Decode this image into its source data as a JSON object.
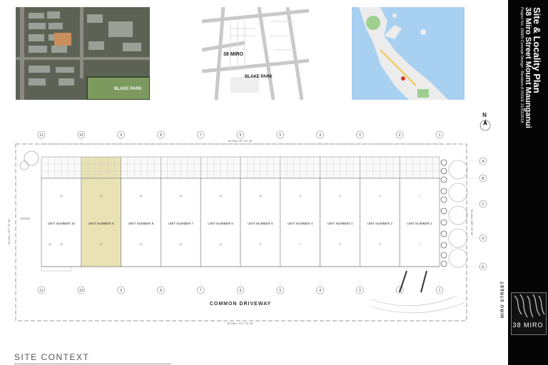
{
  "title_block": {
    "title": "Site & Locality Plan",
    "subtitle": "38 Miro Street Mount Maunganui",
    "project_line": "Project No. 18009   Concept Design - Revision A   ISSUE 21/03/2018"
  },
  "maps": {
    "aerial_label": "BLAKE PARK",
    "street_site_label": "38 MIRO",
    "street_park_label": "BLAKE PARK"
  },
  "plan": {
    "grid_numbers": [
      "11",
      "10",
      "9",
      "8",
      "7",
      "6",
      "5",
      "4",
      "3",
      "2",
      "1"
    ],
    "grid_letters": [
      "A",
      "B",
      "C",
      "D",
      "E"
    ],
    "units": [
      {
        "label": "UNIT NUMBER 10",
        "top_num": "21",
        "bottom_num": "20",
        "mid_num": "19",
        "highlight": false
      },
      {
        "label": "UNIT NUMBER 9",
        "top_num": "18",
        "bottom_num": "17",
        "mid_num": "",
        "highlight": true
      },
      {
        "label": "UNIT NUMBER 8",
        "top_num": "16",
        "bottom_num": "15",
        "mid_num": "",
        "highlight": false
      },
      {
        "label": "UNIT NUMBER 7",
        "top_num": "14",
        "bottom_num": "13",
        "mid_num": "",
        "highlight": false
      },
      {
        "label": "UNIT NUMBER 6",
        "top_num": "12",
        "bottom_num": "11",
        "mid_num": "",
        "highlight": false
      },
      {
        "label": "UNIT NUMBER 5",
        "top_num": "10",
        "bottom_num": "9",
        "mid_num": "",
        "highlight": false
      },
      {
        "label": "UNIT NUMBER 4",
        "top_num": "8",
        "bottom_num": "7",
        "mid_num": "",
        "highlight": false
      },
      {
        "label": "UNIT NUMBER 3",
        "top_num": "6",
        "bottom_num": "5",
        "mid_num": "",
        "highlight": false
      },
      {
        "label": "UNIT NUMBER 2",
        "top_num": "4",
        "bottom_num": "3",
        "mid_num": "",
        "highlight": false
      },
      {
        "label": "UNIT NUMBER 1",
        "top_num": "2",
        "bottom_num": "1",
        "mid_num": "",
        "highlight": false
      }
    ],
    "visitor_label": "VISITOR",
    "driveway_label": "COMMON DRIVEWAY",
    "street_label": "MIRO STREET",
    "north_label": "N",
    "top_dimension": "50.29m, 90° 20' 30\"",
    "left_dimension": "20.12m, 170° 20' 30\"",
    "right_dimension": "20.12m, 350° 20' 30\"",
    "bottom_dimension": "50.29m, 270° 20' 30\"",
    "highlight_color": "#e9e2b4"
  },
  "logo_text": "38 MIRO",
  "footer": {
    "site_context": "SITE CONTEXT"
  }
}
